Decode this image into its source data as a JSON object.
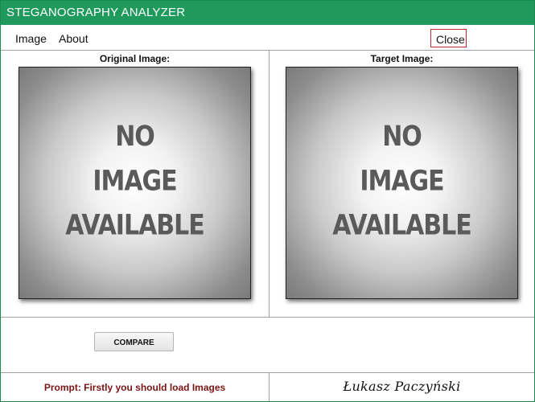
{
  "app": {
    "title": "STEGANOGRAPHY ANALYZER"
  },
  "menu": {
    "items": [
      {
        "label": "Image"
      },
      {
        "label": "About"
      }
    ],
    "close_label": "Close"
  },
  "panels": {
    "original": {
      "label": "Original Image:",
      "placeholder_lines": [
        "NO",
        "IMAGE",
        "AVAILABLE"
      ]
    },
    "target": {
      "label": "Target Image:",
      "placeholder_lines": [
        "NO",
        "IMAGE",
        "AVAILABLE"
      ]
    }
  },
  "compare": {
    "label": "COMPARE"
  },
  "status": {
    "prompt": "Prompt: Firstly you should load Images",
    "author_signature": "Łukasz Paczyński"
  },
  "colors": {
    "titlebar": "#1f9a5c",
    "close_border": "#c0282e",
    "prompt_text": "#7a1414"
  }
}
